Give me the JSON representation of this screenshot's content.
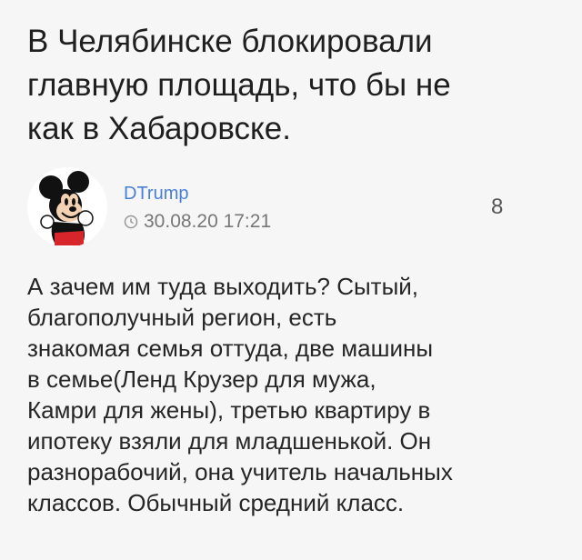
{
  "post": {
    "title": "В Челябинске  блокировали\nглавную площадь, что бы не\nкак в Хабаровске.",
    "author": "DTrump",
    "time": "30.08.20 17:21",
    "comment_count": "8",
    "body": "А зачем им туда выходить? Сытый,\nблагополучный регион, есть\nзнакомая семья оттуда, две машины\nв семье(Ленд Крузер для мужа,\nКамри для жены), третью квартиру в\nипотеку взяли для младшенькой. Он\nразнорабочий, она учитель начальных\nклассов. Обычный средний класс."
  },
  "icons": {
    "avatar": "mickey-mouse-avatar",
    "time": "clock-icon"
  },
  "colors": {
    "background": "#f6f6f6",
    "author_link": "#4a7fd8",
    "muted_text": "#777777"
  }
}
